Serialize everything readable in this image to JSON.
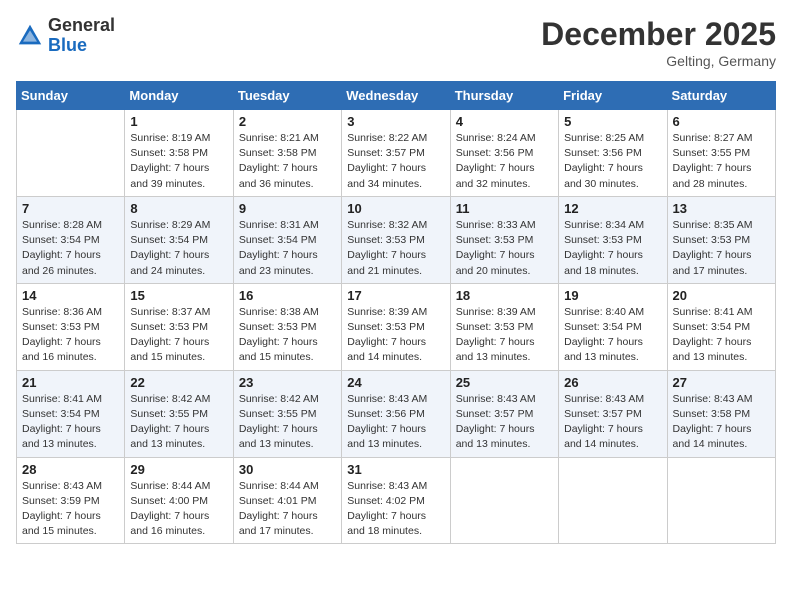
{
  "header": {
    "logo_general": "General",
    "logo_blue": "Blue",
    "month_title": "December 2025",
    "location": "Gelting, Germany"
  },
  "days_of_week": [
    "Sunday",
    "Monday",
    "Tuesday",
    "Wednesday",
    "Thursday",
    "Friday",
    "Saturday"
  ],
  "weeks": [
    [
      {
        "day": "",
        "info": ""
      },
      {
        "day": "1",
        "info": "Sunrise: 8:19 AM\nSunset: 3:58 PM\nDaylight: 7 hours\nand 39 minutes."
      },
      {
        "day": "2",
        "info": "Sunrise: 8:21 AM\nSunset: 3:58 PM\nDaylight: 7 hours\nand 36 minutes."
      },
      {
        "day": "3",
        "info": "Sunrise: 8:22 AM\nSunset: 3:57 PM\nDaylight: 7 hours\nand 34 minutes."
      },
      {
        "day": "4",
        "info": "Sunrise: 8:24 AM\nSunset: 3:56 PM\nDaylight: 7 hours\nand 32 minutes."
      },
      {
        "day": "5",
        "info": "Sunrise: 8:25 AM\nSunset: 3:56 PM\nDaylight: 7 hours\nand 30 minutes."
      },
      {
        "day": "6",
        "info": "Sunrise: 8:27 AM\nSunset: 3:55 PM\nDaylight: 7 hours\nand 28 minutes."
      }
    ],
    [
      {
        "day": "7",
        "info": "Sunrise: 8:28 AM\nSunset: 3:54 PM\nDaylight: 7 hours\nand 26 minutes."
      },
      {
        "day": "8",
        "info": "Sunrise: 8:29 AM\nSunset: 3:54 PM\nDaylight: 7 hours\nand 24 minutes."
      },
      {
        "day": "9",
        "info": "Sunrise: 8:31 AM\nSunset: 3:54 PM\nDaylight: 7 hours\nand 23 minutes."
      },
      {
        "day": "10",
        "info": "Sunrise: 8:32 AM\nSunset: 3:53 PM\nDaylight: 7 hours\nand 21 minutes."
      },
      {
        "day": "11",
        "info": "Sunrise: 8:33 AM\nSunset: 3:53 PM\nDaylight: 7 hours\nand 20 minutes."
      },
      {
        "day": "12",
        "info": "Sunrise: 8:34 AM\nSunset: 3:53 PM\nDaylight: 7 hours\nand 18 minutes."
      },
      {
        "day": "13",
        "info": "Sunrise: 8:35 AM\nSunset: 3:53 PM\nDaylight: 7 hours\nand 17 minutes."
      }
    ],
    [
      {
        "day": "14",
        "info": "Sunrise: 8:36 AM\nSunset: 3:53 PM\nDaylight: 7 hours\nand 16 minutes."
      },
      {
        "day": "15",
        "info": "Sunrise: 8:37 AM\nSunset: 3:53 PM\nDaylight: 7 hours\nand 15 minutes."
      },
      {
        "day": "16",
        "info": "Sunrise: 8:38 AM\nSunset: 3:53 PM\nDaylight: 7 hours\nand 15 minutes."
      },
      {
        "day": "17",
        "info": "Sunrise: 8:39 AM\nSunset: 3:53 PM\nDaylight: 7 hours\nand 14 minutes."
      },
      {
        "day": "18",
        "info": "Sunrise: 8:39 AM\nSunset: 3:53 PM\nDaylight: 7 hours\nand 13 minutes."
      },
      {
        "day": "19",
        "info": "Sunrise: 8:40 AM\nSunset: 3:54 PM\nDaylight: 7 hours\nand 13 minutes."
      },
      {
        "day": "20",
        "info": "Sunrise: 8:41 AM\nSunset: 3:54 PM\nDaylight: 7 hours\nand 13 minutes."
      }
    ],
    [
      {
        "day": "21",
        "info": "Sunrise: 8:41 AM\nSunset: 3:54 PM\nDaylight: 7 hours\nand 13 minutes."
      },
      {
        "day": "22",
        "info": "Sunrise: 8:42 AM\nSunset: 3:55 PM\nDaylight: 7 hours\nand 13 minutes."
      },
      {
        "day": "23",
        "info": "Sunrise: 8:42 AM\nSunset: 3:55 PM\nDaylight: 7 hours\nand 13 minutes."
      },
      {
        "day": "24",
        "info": "Sunrise: 8:43 AM\nSunset: 3:56 PM\nDaylight: 7 hours\nand 13 minutes."
      },
      {
        "day": "25",
        "info": "Sunrise: 8:43 AM\nSunset: 3:57 PM\nDaylight: 7 hours\nand 13 minutes."
      },
      {
        "day": "26",
        "info": "Sunrise: 8:43 AM\nSunset: 3:57 PM\nDaylight: 7 hours\nand 14 minutes."
      },
      {
        "day": "27",
        "info": "Sunrise: 8:43 AM\nSunset: 3:58 PM\nDaylight: 7 hours\nand 14 minutes."
      }
    ],
    [
      {
        "day": "28",
        "info": "Sunrise: 8:43 AM\nSunset: 3:59 PM\nDaylight: 7 hours\nand 15 minutes."
      },
      {
        "day": "29",
        "info": "Sunrise: 8:44 AM\nSunset: 4:00 PM\nDaylight: 7 hours\nand 16 minutes."
      },
      {
        "day": "30",
        "info": "Sunrise: 8:44 AM\nSunset: 4:01 PM\nDaylight: 7 hours\nand 17 minutes."
      },
      {
        "day": "31",
        "info": "Sunrise: 8:43 AM\nSunset: 4:02 PM\nDaylight: 7 hours\nand 18 minutes."
      },
      {
        "day": "",
        "info": ""
      },
      {
        "day": "",
        "info": ""
      },
      {
        "day": "",
        "info": ""
      }
    ]
  ]
}
